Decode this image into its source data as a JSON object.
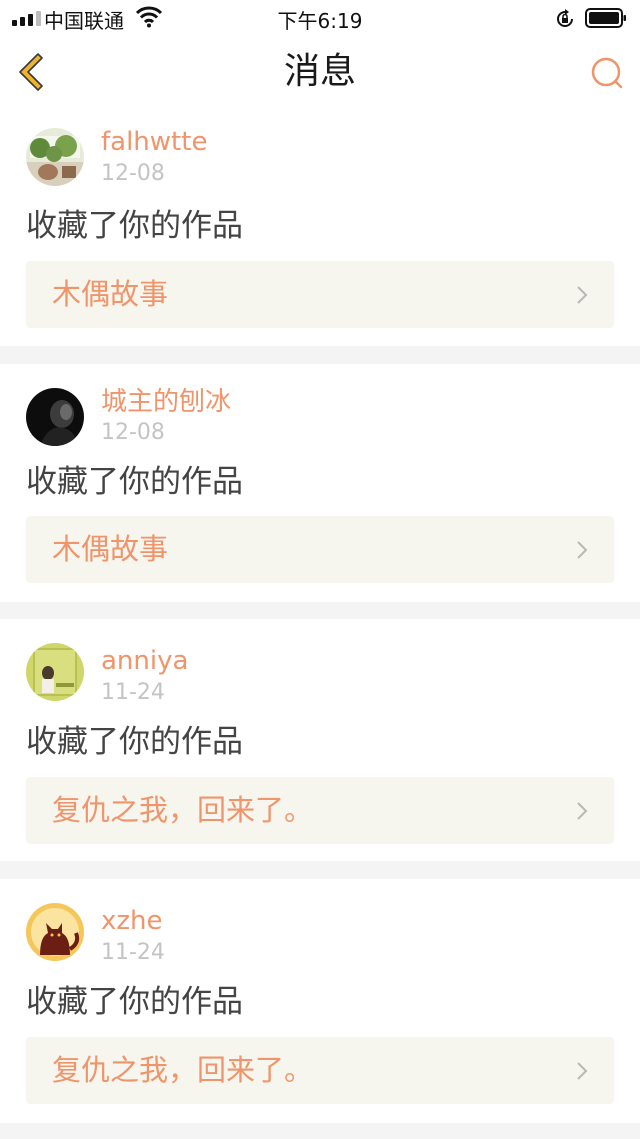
{
  "status_bar": {
    "carrier": "中国联通",
    "time": "下午6:19"
  },
  "nav": {
    "title": "消息",
    "back_icon": "chevron-left-icon",
    "search_icon": "search-icon"
  },
  "colors": {
    "accent": "#f0956b",
    "back_arrow": "#f2b230",
    "link_bg": "#f6f5ee",
    "date_gray": "#c4c4c4"
  },
  "messages": [
    {
      "username": "falhwtte",
      "date": "12-08",
      "action": "收藏了你的作品",
      "work_title": "木偶故事"
    },
    {
      "username": "城主的刨冰",
      "date": "12-08",
      "action": "收藏了你的作品",
      "work_title": "木偶故事"
    },
    {
      "username": "anniya",
      "date": "11-24",
      "action": "收藏了你的作品",
      "work_title": "复仇之我，回来了。"
    },
    {
      "username": "xzhe",
      "date": "11-24",
      "action": "收藏了你的作品",
      "work_title": "复仇之我，回来了。"
    }
  ]
}
